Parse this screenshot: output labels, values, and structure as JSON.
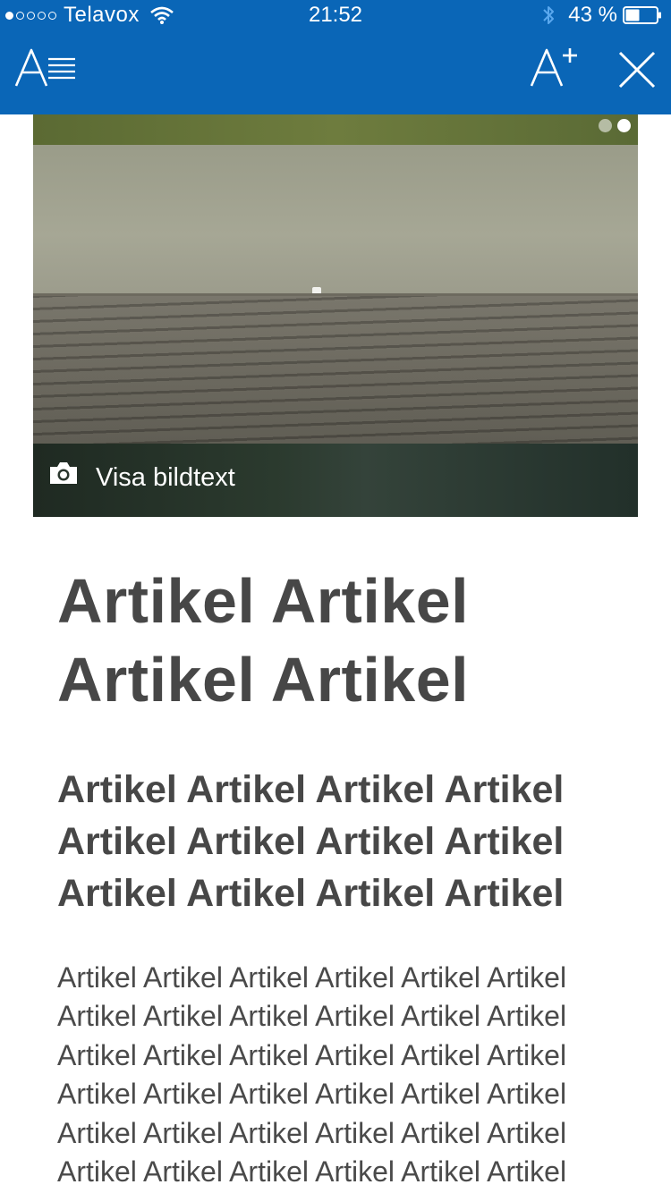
{
  "status_bar": {
    "carrier": "Telavox",
    "time": "21:52",
    "battery": "43 %",
    "signal_bars_filled": 1,
    "signal_bars_total": 5
  },
  "app_bar": {
    "background": "#0a66b7",
    "icons": [
      "reader-view-icon",
      "text-size-increase-icon",
      "close-icon"
    ]
  },
  "hero": {
    "caption_toggle": "Visa bildtext",
    "pager_total": 2,
    "pager_active": 2
  },
  "article": {
    "headline": "Artikel Artikel Artikel Artikel",
    "subheading": "Artikel Artikel Artikel Artikel Artikel Artikel Artikel Artikel Artikel Artikel Artikel Artikel",
    "body": "Artikel Artikel Artikel Artikel Artikel Artikel Artikel Artikel Artikel Artikel Artikel Artikel Artikel Artikel Artikel Artikel Artikel Artikel Artikel Artikel Artikel Artikel Artikel Artikel Artikel Artikel Artikel Artikel Artikel Artikel Artikel Artikel Artikel Artikel Artikel Artikel"
  }
}
